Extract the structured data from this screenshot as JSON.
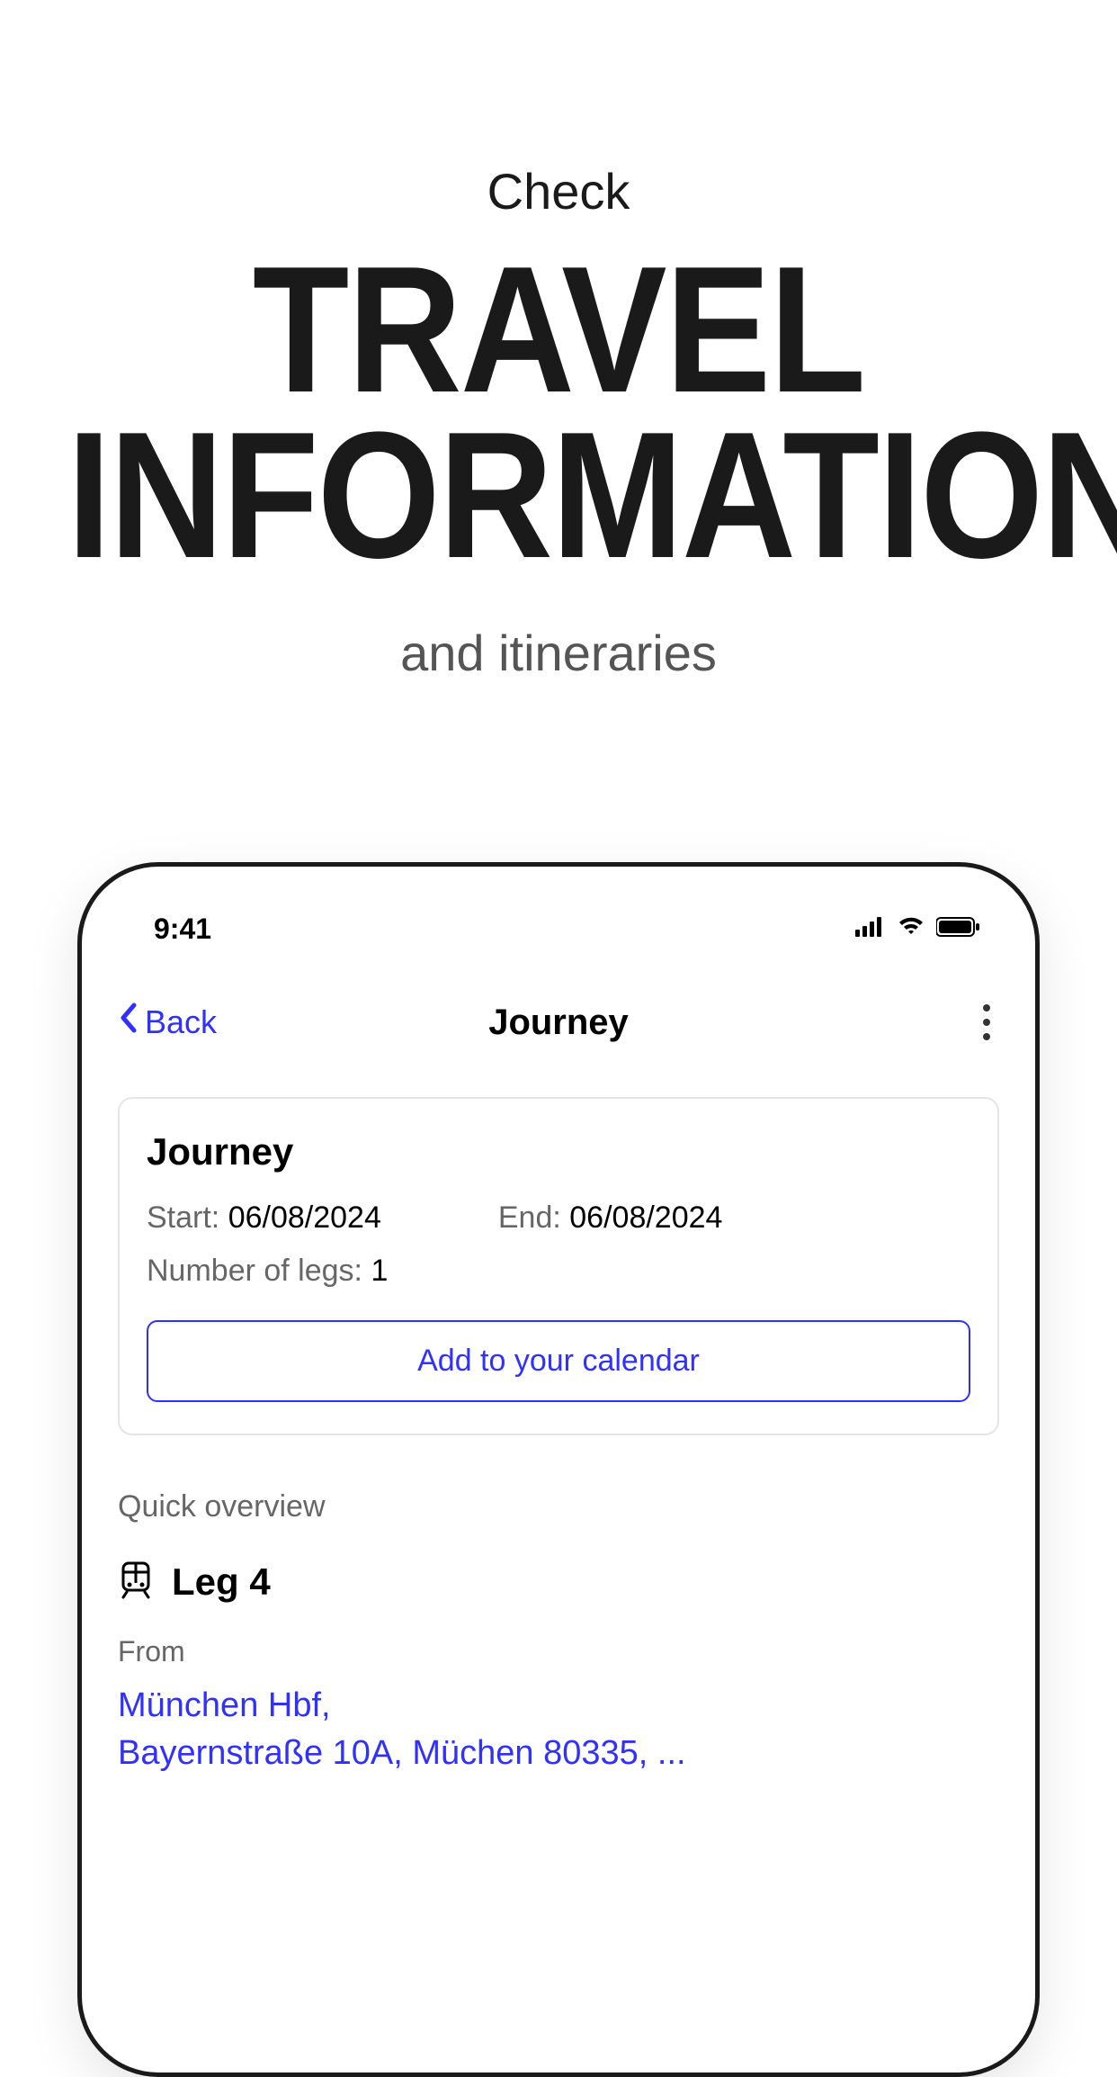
{
  "promo": {
    "check": "Check",
    "title_line1": "TRAVEL",
    "title_line2": "INFORMATION",
    "sub": "and itineraries"
  },
  "status": {
    "time": "9:41"
  },
  "nav": {
    "back_label": "Back",
    "title": "Journey"
  },
  "card": {
    "title": "Journey",
    "start_label": "Start: ",
    "start_value": "06/08/2024",
    "end_label": "End: ",
    "end_value": "06/08/2024",
    "legs_label": "Number of legs: ",
    "legs_value": "1",
    "calendar_button": "Add to your calendar"
  },
  "overview": {
    "title": "Quick overview",
    "leg_title": "Leg 4",
    "from_label": "From",
    "from_address_line1": "München Hbf,",
    "from_address_line2": "Bayernstraße 10A, Müchen 80335, ..."
  }
}
